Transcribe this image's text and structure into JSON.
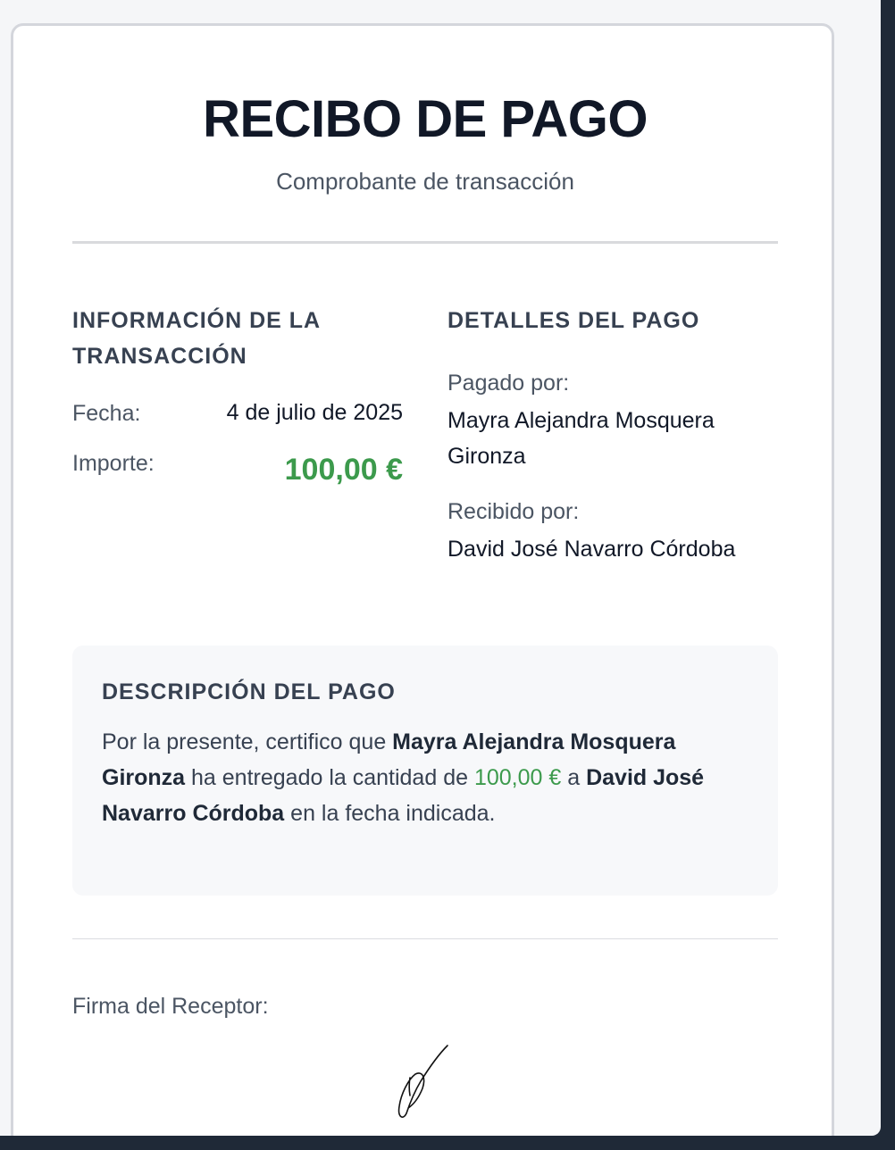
{
  "receipt": {
    "title": "RECIBO DE PAGO",
    "subtitle": "Comprobante de transacción",
    "transaction_info": {
      "heading": "INFORMACIÓN DE LA TRANSACCIÓN",
      "date_label": "Fecha:",
      "date_value": "4 de julio de 2025",
      "amount_label": "Importe:",
      "amount_value": "100,00 €"
    },
    "payment_details": {
      "heading": "DETALLES DEL PAGO",
      "paid_by_label": "Pagado por:",
      "paid_by_value": "Mayra Alejandra Mosquera Gironza",
      "received_by_label": "Recibido por:",
      "received_by_value": "David José Navarro Córdoba"
    },
    "description": {
      "heading": "DESCRIPCIÓN DEL PAGO",
      "part1": "Por la presente, certifico que ",
      "payer": "Mayra Alejandra Mosquera Gironza",
      "part2": " ha entregado la cantidad de ",
      "amount": "100,00 €",
      "part3": " a ",
      "receiver": "David José Navarro Córdoba",
      "part4": " en la fecha indicada."
    },
    "signature_label": "Firma del Receptor:"
  },
  "colors": {
    "amount_green": "#3c9a4c",
    "title_dark": "#111827",
    "muted_text": "#4b5563"
  }
}
